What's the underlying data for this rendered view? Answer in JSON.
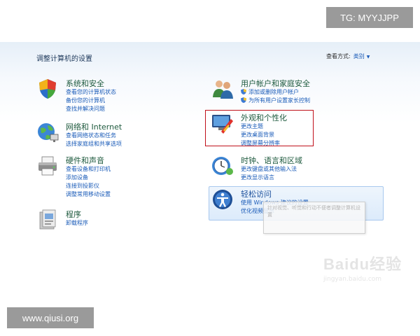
{
  "overlay": {
    "tag": "TG: MYYJJPP",
    "site": "www.qiusi.org"
  },
  "header": {
    "title": "调整计算机的设置",
    "view_by_label": "查看方式:",
    "view_by_value": "类别"
  },
  "categories": {
    "system": {
      "title": "系统和安全",
      "links": [
        "查看您的计算机状态",
        "备份您的计算机",
        "查找并解决问题"
      ]
    },
    "network": {
      "title": "网络和 Internet",
      "links": [
        "查看网络状态和任务",
        "选择家庭组和共享选项"
      ]
    },
    "hardware": {
      "title": "硬件和声音",
      "links": [
        "查看设备和打印机",
        "添加设备",
        "连接到投影仪",
        "调整常用移动设置"
      ]
    },
    "programs": {
      "title": "程序",
      "links": [
        "卸载程序"
      ]
    },
    "users": {
      "title": "用户帐户和家庭安全",
      "links": [
        "添加或删除用户帐户",
        "为所有用户设置家长控制"
      ]
    },
    "appearance": {
      "title": "外观和个性化",
      "links": [
        "更改主题",
        "更改桌面背景",
        "调整屏幕分辨率"
      ]
    },
    "clock": {
      "title": "时钟、语言和区域",
      "links": [
        "更改键盘或其他输入法",
        "更改显示语言"
      ]
    },
    "ease": {
      "title": "轻松访问",
      "links": [
        "使用 Windows 建议的设置",
        "优化视频显示"
      ]
    }
  },
  "tooltip": {
    "text": "针对视觉、听觉和行动不便者调整计算机设置"
  },
  "watermark": {
    "brand": "Baidu经验",
    "url": "jingyan.baidu.com"
  }
}
